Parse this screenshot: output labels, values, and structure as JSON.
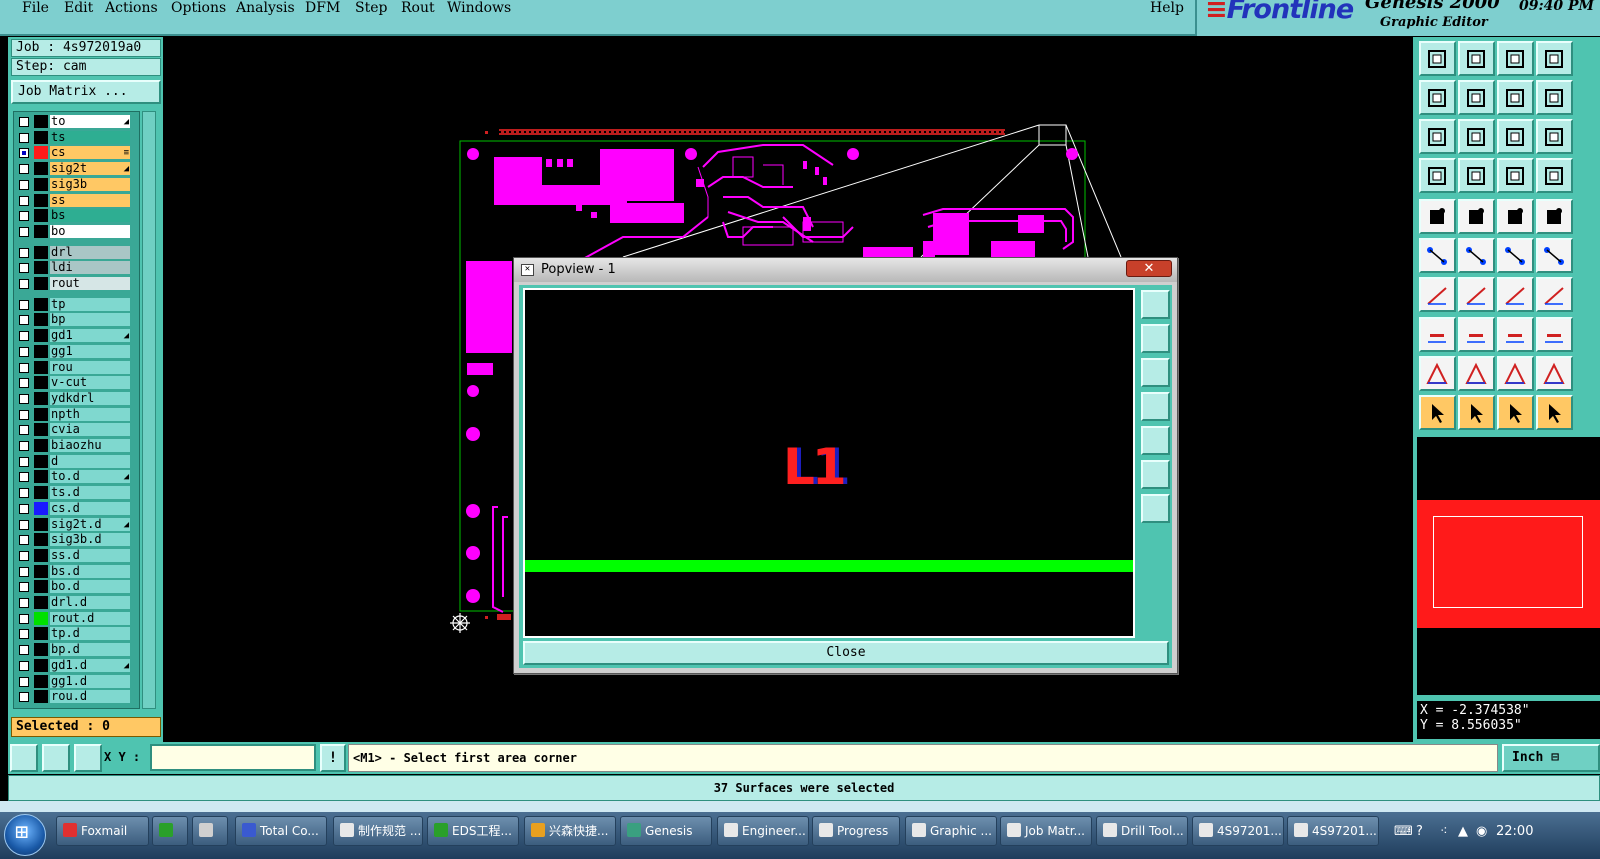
{
  "menubar": {
    "items": [
      "File",
      "Edit",
      "Actions",
      "Options",
      "Analysis",
      "DFM",
      "Step",
      "Rout",
      "Windows"
    ],
    "help": "Help"
  },
  "branding": {
    "logo": "Frontline",
    "product": "Genesis 2000",
    "subtitle": "Graphic Editor",
    "time": "09:40 PM"
  },
  "job": {
    "job_line": "Job : 4s972019a0",
    "step_line": "Step: cam",
    "matrix_button": "Job Matrix ..."
  },
  "layers": [
    {
      "name": "to",
      "style": "white",
      "color": "",
      "checked": false,
      "mark": "◢"
    },
    {
      "name": "ts",
      "style": "teal",
      "color": "",
      "checked": false,
      "mark": ""
    },
    {
      "name": "cs",
      "style": "orange",
      "color": "#ff1a1a",
      "checked": true,
      "mark": "≡"
    },
    {
      "name": "sig2t",
      "style": "orange",
      "color": "",
      "checked": false,
      "mark": "◢"
    },
    {
      "name": "sig3b",
      "style": "orange",
      "color": "",
      "checked": false,
      "mark": ""
    },
    {
      "name": "ss",
      "style": "orange",
      "color": "",
      "checked": false,
      "mark": ""
    },
    {
      "name": "bs",
      "style": "teal",
      "color": "",
      "checked": false,
      "mark": ""
    },
    {
      "name": "bo",
      "style": "white",
      "color": "",
      "checked": false,
      "mark": ""
    },
    {
      "name": "drl",
      "style": "grey",
      "color": "",
      "checked": false,
      "mark": ""
    },
    {
      "name": "ldi",
      "style": "grey",
      "color": "",
      "checked": false,
      "mark": ""
    },
    {
      "name": "rout",
      "style": "lgrey",
      "color": "",
      "checked": false,
      "mark": ""
    },
    {
      "name": "tp",
      "style": "",
      "color": "",
      "checked": false,
      "mark": ""
    },
    {
      "name": "bp",
      "style": "",
      "color": "",
      "checked": false,
      "mark": ""
    },
    {
      "name": "gd1",
      "style": "",
      "color": "",
      "checked": false,
      "mark": "◢"
    },
    {
      "name": "gg1",
      "style": "",
      "color": "",
      "checked": false,
      "mark": ""
    },
    {
      "name": "rou",
      "style": "",
      "color": "",
      "checked": false,
      "mark": ""
    },
    {
      "name": "v-cut",
      "style": "",
      "color": "",
      "checked": false,
      "mark": ""
    },
    {
      "name": "ydkdrl",
      "style": "",
      "color": "",
      "checked": false,
      "mark": ""
    },
    {
      "name": "npth",
      "style": "",
      "color": "",
      "checked": false,
      "mark": ""
    },
    {
      "name": "cvia",
      "style": "",
      "color": "",
      "checked": false,
      "mark": ""
    },
    {
      "name": "biaozhu",
      "style": "",
      "color": "",
      "checked": false,
      "mark": ""
    },
    {
      "name": "d",
      "style": "",
      "color": "",
      "checked": false,
      "mark": ""
    },
    {
      "name": "to.d",
      "style": "",
      "color": "",
      "checked": false,
      "mark": "◢"
    },
    {
      "name": "ts.d",
      "style": "",
      "color": "",
      "checked": false,
      "mark": ""
    },
    {
      "name": "cs.d",
      "style": "",
      "color": "#1a1aff",
      "checked": false,
      "mark": ""
    },
    {
      "name": "sig2t.d",
      "style": "",
      "color": "",
      "checked": false,
      "mark": "◢"
    },
    {
      "name": "sig3b.d",
      "style": "",
      "color": "",
      "checked": false,
      "mark": ""
    },
    {
      "name": "ss.d",
      "style": "",
      "color": "",
      "checked": false,
      "mark": ""
    },
    {
      "name": "bs.d",
      "style": "",
      "color": "",
      "checked": false,
      "mark": ""
    },
    {
      "name": "bo.d",
      "style": "",
      "color": "",
      "checked": false,
      "mark": ""
    },
    {
      "name": "drl.d",
      "style": "",
      "color": "",
      "checked": false,
      "mark": ""
    },
    {
      "name": "rout.d",
      "style": "",
      "color": "#00e000",
      "checked": false,
      "mark": ""
    },
    {
      "name": "tp.d",
      "style": "",
      "color": "",
      "checked": false,
      "mark": ""
    },
    {
      "name": "bp.d",
      "style": "",
      "color": "",
      "checked": false,
      "mark": ""
    },
    {
      "name": "gd1.d",
      "style": "",
      "color": "",
      "checked": false,
      "mark": "◢"
    },
    {
      "name": "gg1.d",
      "style": "",
      "color": "",
      "checked": false,
      "mark": ""
    },
    {
      "name": "rou.d",
      "style": "",
      "color": "",
      "checked": false,
      "mark": ""
    }
  ],
  "selected": "Selected : 0",
  "popview": {
    "title": "Popview - 1",
    "layer_label": "L1",
    "close": "Close",
    "close_x": "✕"
  },
  "coords": {
    "x": "X = -2.374538\"",
    "y": "Y = 8.556035\""
  },
  "cmd": {
    "xy_label": "X Y :",
    "xy_value": "",
    "excl": "!",
    "prompt": "<M1> - Select first area corner",
    "units": "Inch"
  },
  "status": "37 Surfaces were selected",
  "colors": {
    "panel": "#4fc4b0",
    "trace": "#ff00ff",
    "outline": "#00c000",
    "highlight": "#ff1a1a"
  },
  "taskbar": {
    "items": [
      {
        "label": "Foxmail",
        "icon_color": "#e03030"
      },
      {
        "label": "",
        "icon_color": "#2aa02a"
      },
      {
        "label": "",
        "icon_color": "#d0d0d0"
      },
      {
        "label": "Total Co...",
        "icon_color": "#3a5ad0"
      },
      {
        "label": "制作规范 ...",
        "icon_color": "#e8e8e8"
      },
      {
        "label": "EDS工程...",
        "icon_color": "#2aa02a"
      },
      {
        "label": "兴森快捷...",
        "icon_color": "#e8a020"
      },
      {
        "label": "Genesis",
        "icon_color": "#3aa080"
      },
      {
        "label": "Engineer...",
        "icon_color": "#e8e8e8"
      },
      {
        "label": "Progress",
        "icon_color": "#e8e8e8"
      },
      {
        "label": "Graphic ...",
        "icon_color": "#e8e8e8"
      },
      {
        "label": "Job Matr...",
        "icon_color": "#e8e8e8"
      },
      {
        "label": "Drill Tool...",
        "icon_color": "#e8e8e8"
      },
      {
        "label": "4S97201...",
        "icon_color": "#e8e8e8"
      },
      {
        "label": "4S97201...",
        "icon_color": "#e8e8e8"
      }
    ],
    "clock": "22:00"
  }
}
